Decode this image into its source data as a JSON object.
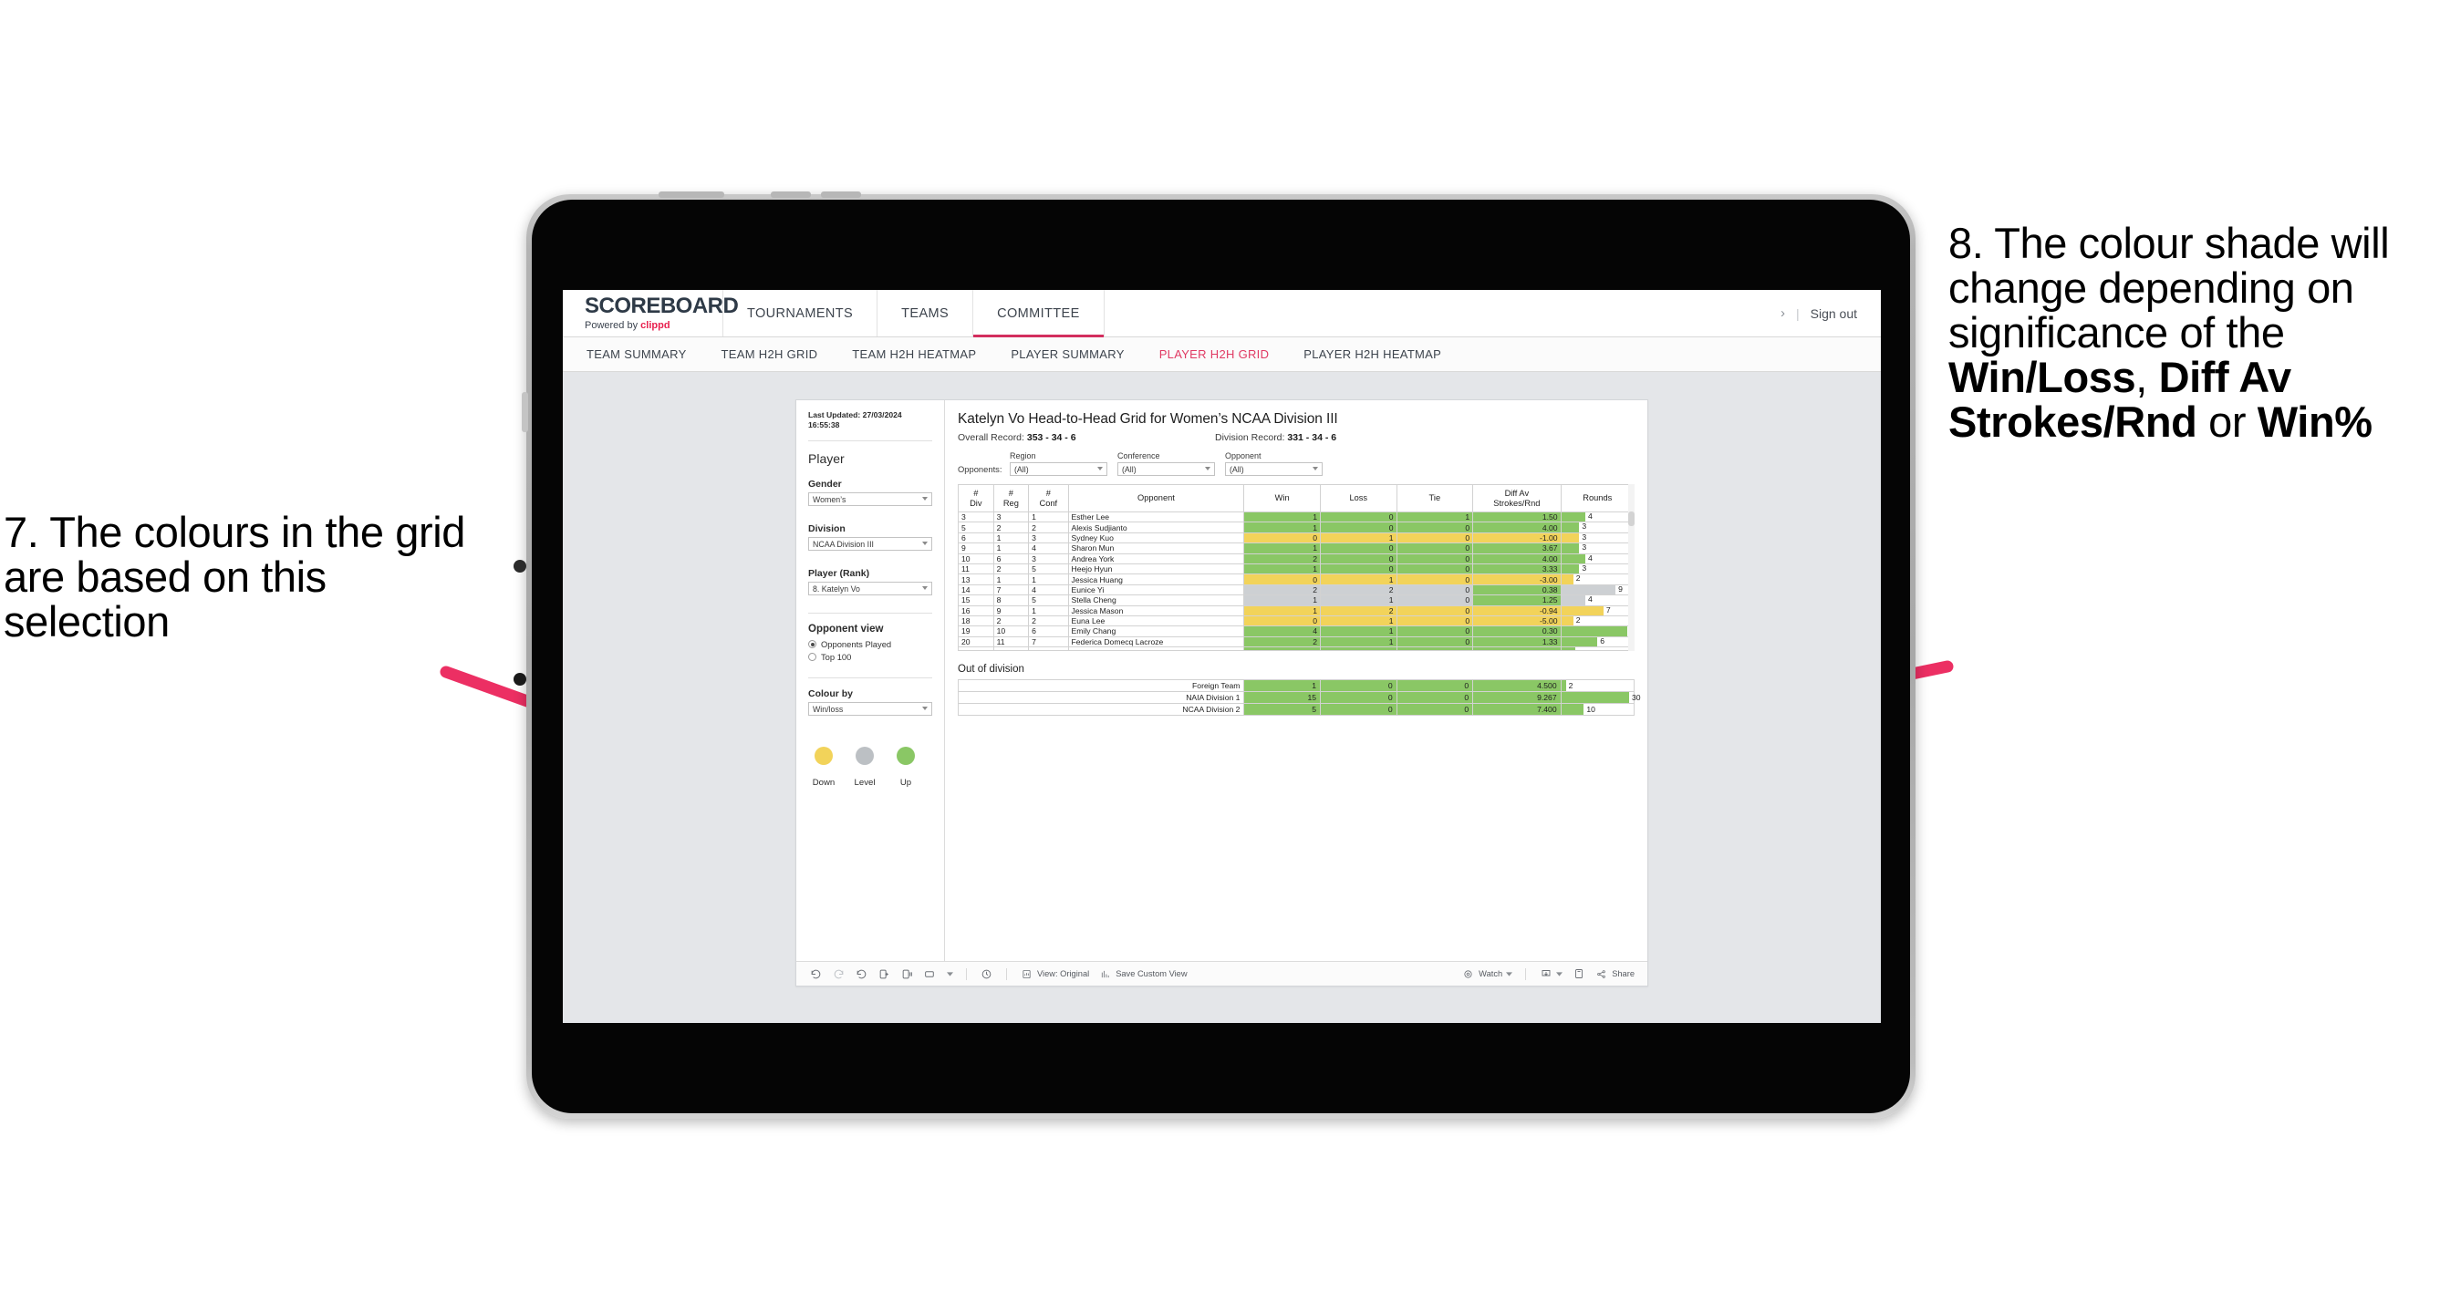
{
  "annotations": {
    "left": "7. The colours in the grid are based on this selection",
    "right_pre": "8. The colour shade will change depending on significance of the ",
    "right_b1": "Win/Loss",
    "right_mid1": ", ",
    "right_b2": "Diff Av Strokes/Rnd",
    "right_mid2": " or ",
    "right_b3": "Win%",
    "arrow_color": "#ec2f63"
  },
  "app": {
    "brand_title": "SCOREBOARD",
    "brand_sub_pre": "Powered by ",
    "brand_sub_accent": "clippd",
    "nav": [
      {
        "label": "TOURNAMENTS",
        "active": false
      },
      {
        "label": "TEAMS",
        "active": false
      },
      {
        "label": "COMMITTEE",
        "active": true
      }
    ],
    "chevron": "›",
    "separator": "|",
    "sign_out": "Sign out",
    "subnav": [
      {
        "label": "TEAM SUMMARY",
        "active": false
      },
      {
        "label": "TEAM H2H GRID",
        "active": false
      },
      {
        "label": "TEAM H2H HEATMAP",
        "active": false
      },
      {
        "label": "PLAYER SUMMARY",
        "active": false
      },
      {
        "label": "PLAYER H2H GRID",
        "active": true
      },
      {
        "label": "PLAYER H2H HEATMAP",
        "active": false
      }
    ]
  },
  "panel": {
    "last_updated": "Last Updated: 27/03/2024 16:55:38",
    "heading": "Player",
    "gender_label": "Gender",
    "gender_value": "Women’s",
    "division_label": "Division",
    "division_value": "NCAA Division III",
    "player_label": "Player (Rank)",
    "player_value": "8. Katelyn Vo",
    "opponent_view_label": "Opponent view",
    "opponent_options": [
      {
        "label": "Opponents Played",
        "selected": true
      },
      {
        "label": "Top 100",
        "selected": false
      }
    ],
    "colour_by_label": "Colour by",
    "colour_by_value": "Win/loss",
    "legend": [
      {
        "label": "Down",
        "color": "#f2d35a"
      },
      {
        "label": "Level",
        "color": "#bcc0c4"
      },
      {
        "label": "Up",
        "color": "#8ac765"
      }
    ]
  },
  "viz": {
    "title": "Katelyn Vo Head-to-Head Grid for Women’s NCAA Division III",
    "overall_record_label": "Overall Record: ",
    "overall_record_value": "353 -  34 - 6",
    "division_record_label": "Division Record: ",
    "division_record_value": "331 -  34 - 6",
    "opponents_label": "Opponents:",
    "filters": [
      {
        "label": "Region",
        "value": "(All)"
      },
      {
        "label": "Conference",
        "value": "(All)"
      },
      {
        "label": "Opponent",
        "value": "(All)"
      }
    ],
    "columns": [
      "# Div",
      "# Reg",
      "# Conf",
      "Opponent",
      "Win",
      "Loss",
      "Tie",
      "Diff Av Strokes/Rnd",
      "Rounds"
    ],
    "out_of_division_title": "Out of division"
  },
  "chart_data": {
    "type": "table",
    "title": "Katelyn Vo Head-to-Head Grid for Women’s NCAA Division III",
    "columns": [
      "#Div",
      "#Reg",
      "#Conf",
      "Opponent",
      "Win",
      "Loss",
      "Tie",
      "Diff Av Strokes/Rnd",
      "Rounds"
    ],
    "colors": {
      "up": "#8ac765",
      "down": "#f2d35a",
      "level": "#cdd0d3"
    },
    "rounds_max": 12,
    "rows": [
      {
        "div": "3",
        "reg": "3",
        "conf": "1",
        "opponent": "Esther Lee",
        "win": "1",
        "loss": "0",
        "tie": "1",
        "diff": "1.50",
        "rounds": "4",
        "rounds_n": 4,
        "shade": "up"
      },
      {
        "div": "5",
        "reg": "2",
        "conf": "2",
        "opponent": "Alexis Sudjianto",
        "win": "1",
        "loss": "0",
        "tie": "0",
        "diff": "4.00",
        "rounds": "3",
        "rounds_n": 3,
        "shade": "up"
      },
      {
        "div": "6",
        "reg": "1",
        "conf": "3",
        "opponent": "Sydney Kuo",
        "win": "0",
        "loss": "1",
        "tie": "0",
        "diff": "-1.00",
        "rounds": "3",
        "rounds_n": 3,
        "shade": "down"
      },
      {
        "div": "9",
        "reg": "1",
        "conf": "4",
        "opponent": "Sharon Mun",
        "win": "1",
        "loss": "0",
        "tie": "0",
        "diff": "3.67",
        "rounds": "3",
        "rounds_n": 3,
        "shade": "up"
      },
      {
        "div": "10",
        "reg": "6",
        "conf": "3",
        "opponent": "Andrea York",
        "win": "2",
        "loss": "0",
        "tie": "0",
        "diff": "4.00",
        "rounds": "4",
        "rounds_n": 4,
        "shade": "up"
      },
      {
        "div": "11",
        "reg": "2",
        "conf": "5",
        "opponent": "Heejo Hyun",
        "win": "1",
        "loss": "0",
        "tie": "0",
        "diff": "3.33",
        "rounds": "3",
        "rounds_n": 3,
        "shade": "up"
      },
      {
        "div": "13",
        "reg": "1",
        "conf": "1",
        "opponent": "Jessica Huang",
        "win": "0",
        "loss": "1",
        "tie": "0",
        "diff": "-3.00",
        "rounds": "2",
        "rounds_n": 2,
        "shade": "down"
      },
      {
        "div": "14",
        "reg": "7",
        "conf": "4",
        "opponent": "Eunice Yi",
        "win": "2",
        "loss": "2",
        "tie": "0",
        "diff": "0.38",
        "rounds": "9",
        "rounds_n": 9,
        "shade": "level",
        "diff_shade": "up"
      },
      {
        "div": "15",
        "reg": "8",
        "conf": "5",
        "opponent": "Stella Cheng",
        "win": "1",
        "loss": "1",
        "tie": "0",
        "diff": "1.25",
        "rounds": "4",
        "rounds_n": 4,
        "shade": "level",
        "diff_shade": "up"
      },
      {
        "div": "16",
        "reg": "9",
        "conf": "1",
        "opponent": "Jessica Mason",
        "win": "1",
        "loss": "2",
        "tie": "0",
        "diff": "-0.94",
        "rounds": "7",
        "rounds_n": 7,
        "shade": "down"
      },
      {
        "div": "18",
        "reg": "2",
        "conf": "2",
        "opponent": "Euna Lee",
        "win": "0",
        "loss": "1",
        "tie": "0",
        "diff": "-5.00",
        "rounds": "2",
        "rounds_n": 2,
        "shade": "down"
      },
      {
        "div": "19",
        "reg": "10",
        "conf": "6",
        "opponent": "Emily Chang",
        "win": "4",
        "loss": "1",
        "tie": "0",
        "diff": "0.30",
        "rounds": "11",
        "rounds_n": 11,
        "shade": "up"
      },
      {
        "div": "20",
        "reg": "11",
        "conf": "7",
        "opponent": "Federica Domecq Lacroze",
        "win": "2",
        "loss": "1",
        "tie": "0",
        "diff": "1.33",
        "rounds": "6",
        "rounds_n": 6,
        "shade": "up"
      }
    ],
    "out_of_division": [
      {
        "name": "Foreign Team",
        "win": "1",
        "loss": "0",
        "tie": "0",
        "diff": "4.500",
        "rounds": "2",
        "rounds_n": 2,
        "shade": "up"
      },
      {
        "name": "NAIA Division 1",
        "win": "15",
        "loss": "0",
        "tie": "0",
        "diff": "9.267",
        "rounds": "30",
        "rounds_n": 30,
        "shade": "up"
      },
      {
        "name": "NCAA Division 2",
        "win": "5",
        "loss": "0",
        "tie": "0",
        "diff": "7.400",
        "rounds": "10",
        "rounds_n": 10,
        "shade": "up"
      }
    ],
    "out_of_division_rounds_max": 32
  },
  "toolbar": {
    "undo": "undo-icon",
    "redo": "redo-icon",
    "revert": "revert-icon",
    "refresh": "refresh-data-icon",
    "pause": "pause-icon",
    "view_original_label": "View: Original",
    "save_custom_view_label": "Save Custom View",
    "watch_label": "Watch",
    "share_label": "Share"
  }
}
